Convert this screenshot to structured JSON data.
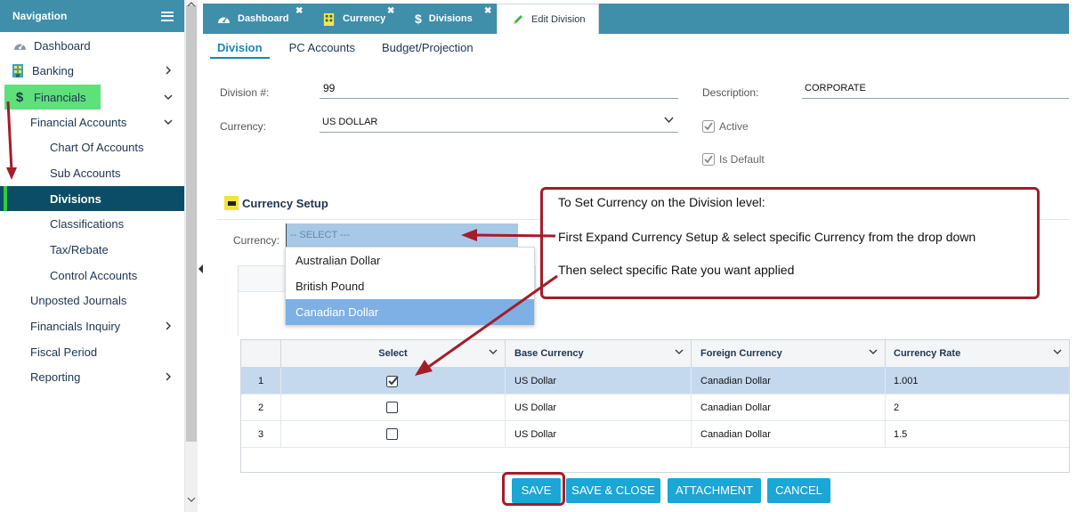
{
  "nav": {
    "title": "Navigation",
    "items": [
      {
        "label": "Dashboard"
      },
      {
        "label": "Banking"
      },
      {
        "label": "Financials"
      },
      {
        "label": "Financial Accounts"
      },
      {
        "label": "Chart Of Accounts"
      },
      {
        "label": "Sub Accounts"
      },
      {
        "label": "Divisions"
      },
      {
        "label": "Classifications"
      },
      {
        "label": "Tax/Rebate"
      },
      {
        "label": "Control Accounts"
      },
      {
        "label": "Unposted Journals"
      },
      {
        "label": "Financials Inquiry"
      },
      {
        "label": "Fiscal Period"
      },
      {
        "label": "Reporting"
      }
    ]
  },
  "tabs": [
    {
      "label": "Dashboard",
      "icon": "gauge-icon"
    },
    {
      "label": "Currency",
      "icon": "building-icon"
    },
    {
      "label": "Divisions",
      "icon": "dollar-icon"
    },
    {
      "label": "Edit Division",
      "icon": "pencil-icon"
    }
  ],
  "subtabs": [
    "Division",
    "PC Accounts",
    "Budget/Projection"
  ],
  "form": {
    "division_label": "Division #:",
    "division_value": "99",
    "currency_label": "Currency:",
    "currency_value": "US DOLLAR",
    "description_label": "Description:",
    "description_value": "CORPORATE",
    "active_label": "Active",
    "default_label": "Is Default"
  },
  "currency_setup": {
    "title": "Currency Setup",
    "currency_label": "Currency:",
    "select_placeholder": "-- SELECT ---",
    "options": [
      "Australian Dollar",
      "British Pound",
      "Canadian Dollar"
    ],
    "highlighted_option": "Canadian Dollar"
  },
  "grid": {
    "columns": [
      "Select",
      "Base Currency",
      "Foreign Currency",
      "Currency Rate"
    ],
    "rows": [
      {
        "num": "1",
        "selected": true,
        "base": "US Dollar",
        "foreign": "Canadian Dollar",
        "rate": "1.001"
      },
      {
        "num": "2",
        "selected": false,
        "base": "US Dollar",
        "foreign": "Canadian Dollar",
        "rate": "2"
      },
      {
        "num": "3",
        "selected": false,
        "base": "US Dollar",
        "foreign": "Canadian Dollar",
        "rate": "1.5"
      }
    ]
  },
  "buttons": {
    "save": "SAVE",
    "save_close": "SAVE & CLOSE",
    "attachment": "ATTACHMENT",
    "cancel": "CANCEL"
  },
  "callout": {
    "line1": "To Set Currency on the Division level:",
    "line2": "First Expand Currency Setup & select specific Currency from the drop down",
    "line3": "Then select specific Rate you want applied"
  },
  "colors": {
    "header_blue": "#3f8eaa",
    "active_nav": "#0b4d66",
    "annotation_red": "#a31d2a",
    "button_blue": "#1aa6d6"
  }
}
